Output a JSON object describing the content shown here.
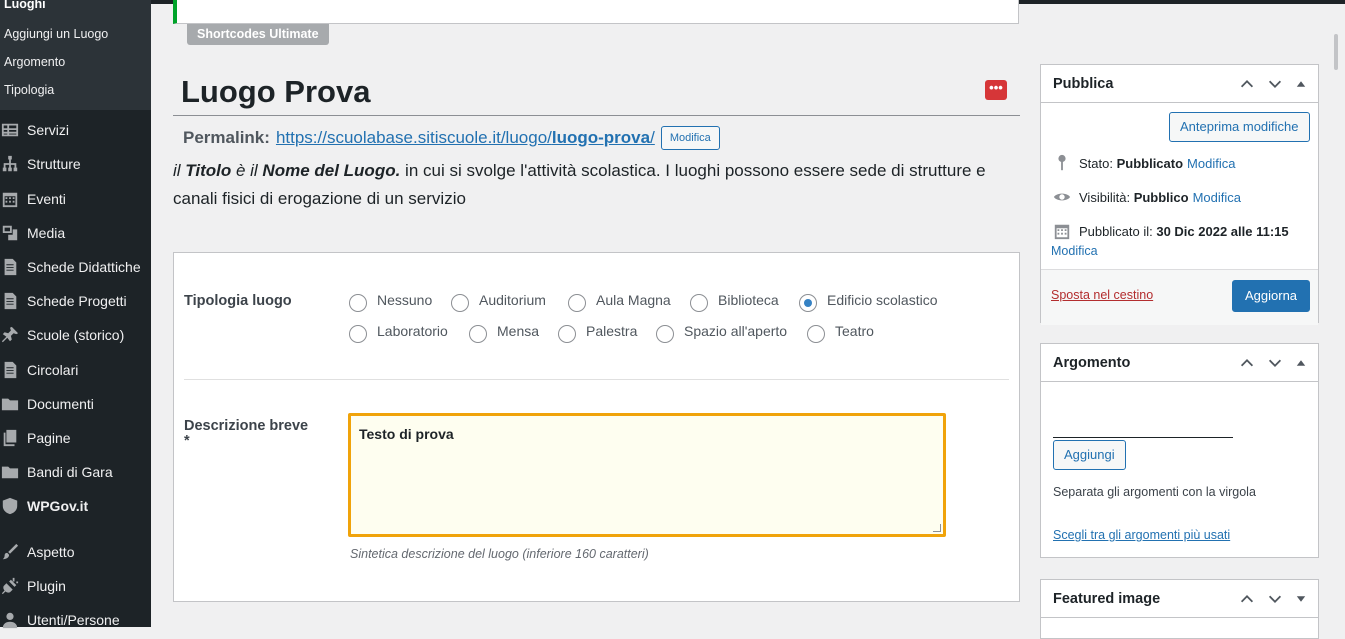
{
  "sidebar": {
    "submenu": [
      {
        "label": "Luoghi",
        "current": true
      },
      {
        "label": "Aggiungi un Luogo"
      },
      {
        "label": "Argomento"
      },
      {
        "label": "Tipologia"
      }
    ],
    "items": [
      {
        "label": "Servizi",
        "icon": "table-icon"
      },
      {
        "label": "Strutture",
        "icon": "sitemap-icon"
      },
      {
        "label": "Eventi",
        "icon": "calendar-icon"
      },
      {
        "label": "Media",
        "icon": "media-icon"
      },
      {
        "label": "Schede Didattiche",
        "icon": "document-icon"
      },
      {
        "label": "Schede Progetti",
        "icon": "document-icon"
      },
      {
        "label": "Scuole (storico)",
        "icon": "pin-icon"
      },
      {
        "label": "Circolari",
        "icon": "document-icon"
      },
      {
        "label": "Documenti",
        "icon": "folder-icon"
      },
      {
        "label": "Pagine",
        "icon": "pages-icon"
      },
      {
        "label": "Bandi di Gara",
        "icon": "folder-icon"
      },
      {
        "label": "WPGov.it",
        "icon": "shield-icon"
      },
      {
        "label": "Aspetto",
        "icon": "brush-icon"
      },
      {
        "label": "Plugin",
        "icon": "plug-icon"
      },
      {
        "label": "Utenti/Persone",
        "icon": "user-icon"
      }
    ]
  },
  "toolbar": {
    "shortcodes_label": "Shortcodes Ultimate"
  },
  "post": {
    "title": "Luogo Prova",
    "permalink_label": "Permalink:",
    "permalink_base": "https://scuolabase.sitiscuole.it/luogo/",
    "permalink_slug": "luogo-prova",
    "permalink_end": "/",
    "permalink_edit": "Modifica"
  },
  "description": {
    "part1": "il ",
    "titolo": "Titolo",
    "part2": " è il ",
    "nome": "Nome del Luogo.",
    "part3": " in cui si svolge l'attività scolastica. I luoghi possono essere sede di strutture e canali fisici di erogazione di un servizio"
  },
  "metabox": {
    "tipologia_label": "Tipologia luogo",
    "options": [
      {
        "label": "Nessuno",
        "checked": false
      },
      {
        "label": "Auditorium",
        "checked": false
      },
      {
        "label": "Aula Magna",
        "checked": false
      },
      {
        "label": "Biblioteca",
        "checked": false
      },
      {
        "label": "Edificio scolastico",
        "checked": true
      },
      {
        "label": "Laboratorio",
        "checked": false
      },
      {
        "label": "Mensa",
        "checked": false
      },
      {
        "label": "Palestra",
        "checked": false
      },
      {
        "label": "Spazio all'aperto",
        "checked": false
      },
      {
        "label": "Teatro",
        "checked": false
      }
    ],
    "descrizione_label": "Descrizione breve",
    "required_mark": "*",
    "descrizione_value": "Testo di prova",
    "descrizione_hint": "Sintetica descrizione del luogo (inferiore 160 caratteri)"
  },
  "publish": {
    "title": "Pubblica",
    "preview_button": "Anteprima modifiche",
    "status_label": "Stato:",
    "status_value": "Pubblicato",
    "visibility_label": "Visibilità:",
    "visibility_value": "Pubblico",
    "published_label": "Pubblicato il:",
    "published_value": "30 Dic 2022 alle 11:15",
    "edit_link": "Modifica",
    "trash_link": "Sposta nel cestino",
    "update_button": "Aggiorna"
  },
  "argomento": {
    "title": "Argomento",
    "add_button": "Aggiungi",
    "help": "Separata gli argomenti con la virgola",
    "popular_link": "Scegli tra gli argomenti più usati"
  },
  "featured": {
    "title": "Featured image"
  },
  "colors": {
    "sidebar_bg": "#1d2327",
    "accent": "#2271b1",
    "focus_border": "#f0a30a",
    "trash": "#b32d2e"
  }
}
